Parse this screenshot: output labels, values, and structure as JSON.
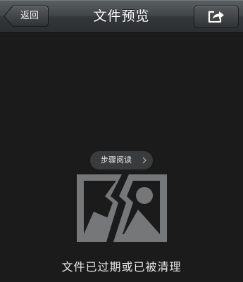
{
  "navbar": {
    "back_label": "返回",
    "title": "文件预览",
    "share_icon": "share-icon"
  },
  "content": {
    "step_read_label": "步骤阅读",
    "placeholder_icon": "broken-image-icon",
    "expired_message": "文件已过期或已被清理"
  },
  "colors": {
    "background": "#1b1b1b",
    "navbar": "#3a3e41",
    "icon_gray": "#767779"
  }
}
